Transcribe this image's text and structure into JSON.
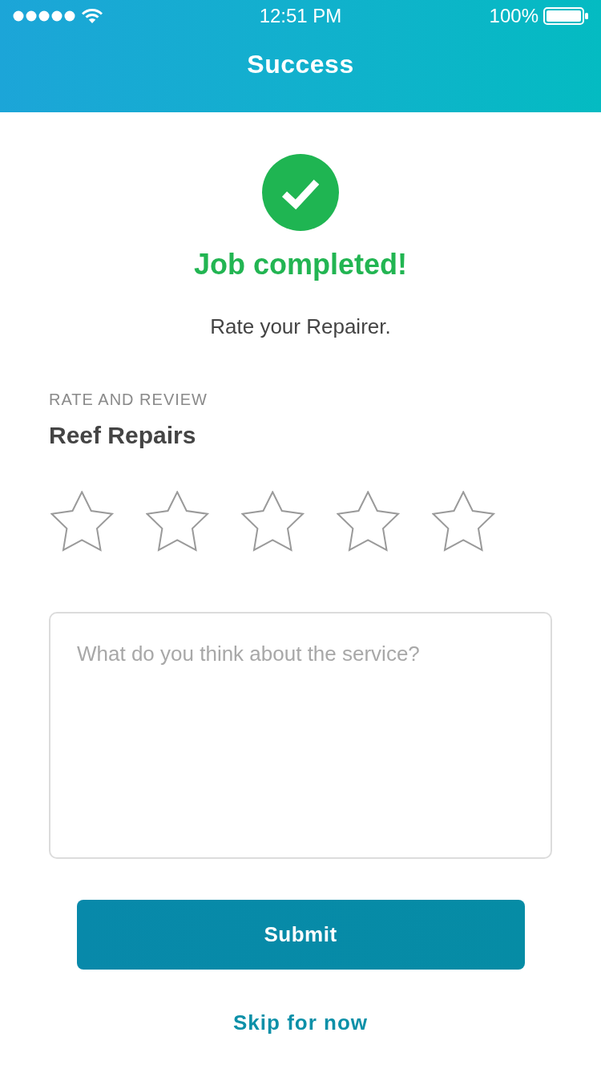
{
  "status_bar": {
    "time": "12:51 PM",
    "battery": "100%"
  },
  "nav_bar": {
    "title": "Success"
  },
  "confirmation": {
    "heading": "Job completed!",
    "subtitle": "Rate your Repairer."
  },
  "review": {
    "section_label": "RATE AND REVIEW",
    "repairer_name": "Reef Repairs",
    "stars": 0,
    "comment": {
      "placeholder": "What do you think about the service?"
    }
  },
  "actions": {
    "submit": "Submit",
    "skip": "Skip for now"
  }
}
